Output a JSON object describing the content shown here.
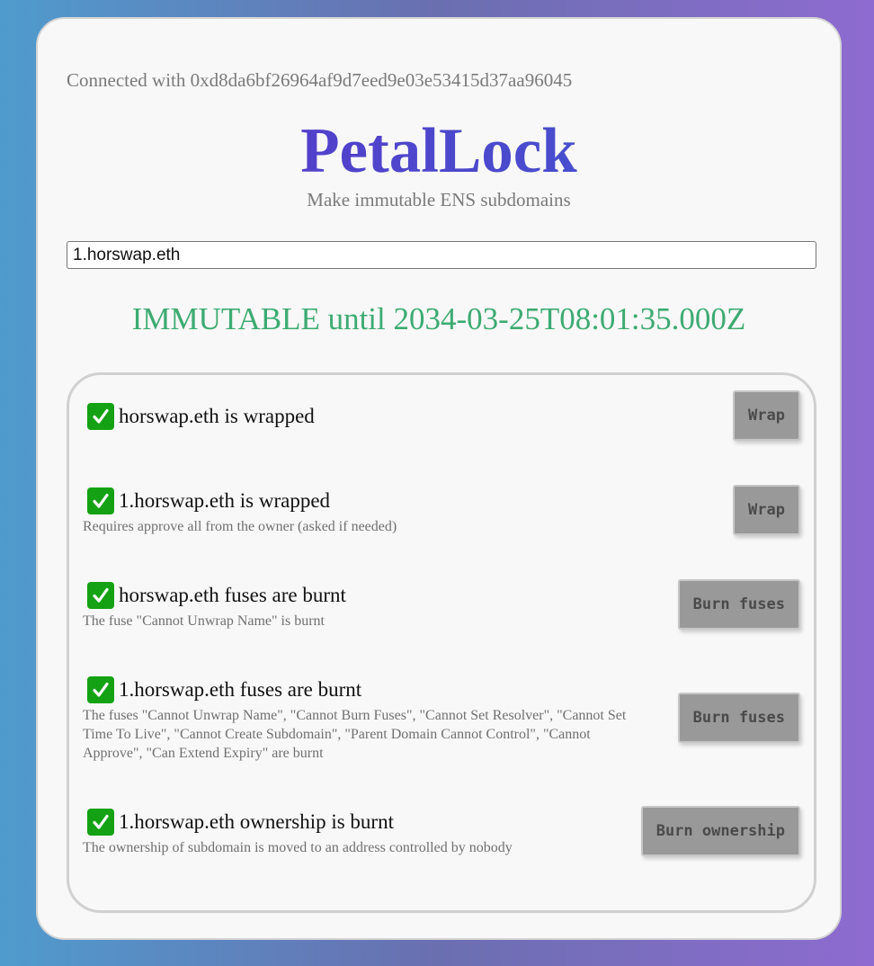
{
  "header": {
    "connected_text": "Connected with 0xd8da6bf26964af9d7eed9e03e53415d37aa96045",
    "title": "PetalLock",
    "subtitle": "Make immutable ENS subdomains"
  },
  "domain_input": {
    "value": "1.horswap.eth"
  },
  "status": {
    "text": "IMMUTABLE until 2034-03-25T08:01:35.000Z",
    "color": "#3dab72"
  },
  "checks": [
    {
      "label": "horswap.eth is wrapped",
      "description": "",
      "checked": true,
      "button_label": "Wrap"
    },
    {
      "label": "1.horswap.eth is wrapped",
      "description": "Requires approve all from the owner (asked if needed)",
      "checked": true,
      "button_label": "Wrap"
    },
    {
      "label": "horswap.eth fuses are burnt",
      "description": "The fuse \"Cannot Unwrap Name\" is burnt",
      "checked": true,
      "button_label": "Burn fuses"
    },
    {
      "label": "1.horswap.eth fuses are burnt",
      "description": "The fuses \"Cannot Unwrap Name\", \"Cannot Burn Fuses\", \"Cannot Set Resolver\", \"Cannot Set Time To Live\", \"Cannot Create Subdomain\", \"Parent Domain Cannot Control\", \"Cannot Approve\", \"Can Extend Expiry\" are burnt",
      "checked": true,
      "button_label": "Burn fuses"
    },
    {
      "label": "1.horswap.eth ownership is burnt",
      "description": "The ownership of subdomain is moved to an address controlled by nobody",
      "checked": true,
      "button_label": "Burn ownership"
    }
  ],
  "colors": {
    "title_gradient_start": "#5d33c8",
    "title_gradient_end": "#3d5bd0",
    "check_green": "#14a214",
    "button_gray": "#999999"
  }
}
